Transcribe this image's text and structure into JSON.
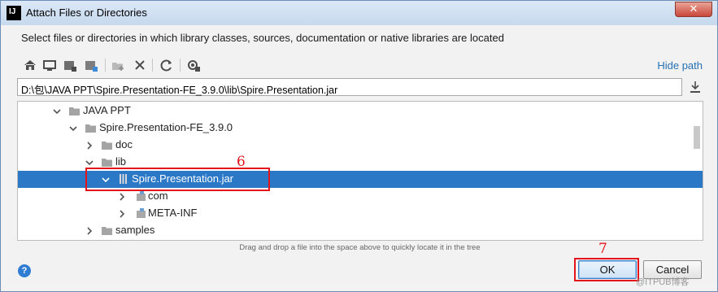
{
  "window": {
    "title": "Attach Files or Directories",
    "app_icon_text": "IJ"
  },
  "instructions": "Select files or directories in which library classes, sources, documentation or native libraries are located",
  "toolbar": {
    "hide_path_label": "Hide path"
  },
  "path_field": {
    "value": "D:\\包\\JAVA PPT\\Spire.Presentation-FE_3.9.0\\lib\\Spire.Presentation.jar"
  },
  "tree": {
    "items": [
      {
        "label": "JAVA PPT",
        "icon": "folder-icon",
        "expanded": true
      },
      {
        "label": "Spire.Presentation-FE_3.9.0",
        "icon": "folder-icon",
        "expanded": true
      },
      {
        "label": "doc",
        "icon": "folder-icon",
        "expanded": false
      },
      {
        "label": "lib",
        "icon": "folder-icon",
        "expanded": true
      },
      {
        "label": "Spire.Presentation.jar",
        "icon": "jar-icon",
        "expanded": true,
        "selected": true
      },
      {
        "label": "com",
        "icon": "package-icon",
        "expanded": false
      },
      {
        "label": "META-INF",
        "icon": "package-icon",
        "expanded": false
      },
      {
        "label": "samples",
        "icon": "folder-icon",
        "expanded": false
      }
    ]
  },
  "drag_hint": "Drag and drop a file into the space above to quickly locate it in the tree",
  "buttons": {
    "help": "?",
    "ok": "OK",
    "cancel": "Cancel"
  },
  "annotations": {
    "step_jar": "6",
    "step_ok": "7"
  },
  "watermark": "@ITPUB博客",
  "colors": {
    "selection": "#2a78c6",
    "annotation": "#e3141b",
    "link": "#2470b3"
  }
}
